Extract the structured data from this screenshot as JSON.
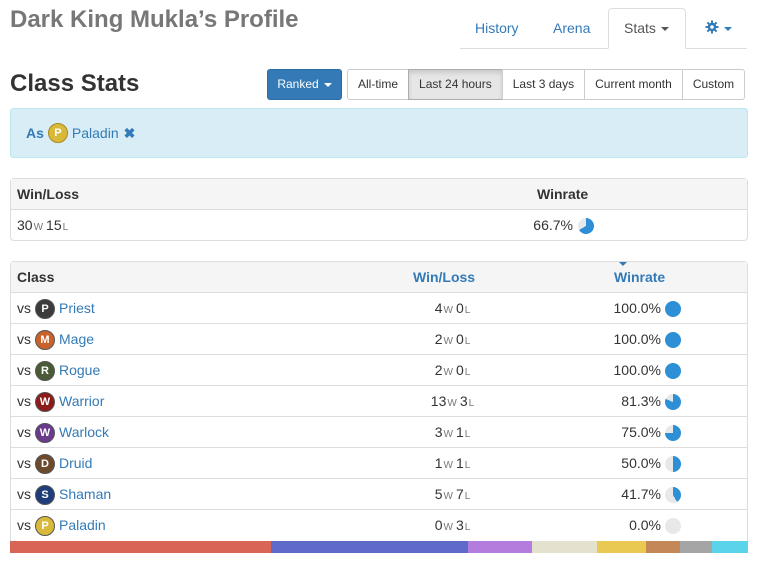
{
  "profile": {
    "title": "Dark King Mukla’s Profile"
  },
  "tabs": [
    {
      "label": "History"
    },
    {
      "label": "Arena"
    },
    {
      "label": "Stats"
    }
  ],
  "settings_icon": "gear-icon",
  "section": {
    "title": "Class Stats"
  },
  "mode": {
    "label": "Ranked"
  },
  "time_ranges": [
    {
      "label": "All-time",
      "active": false
    },
    {
      "label": "Last 24 hours",
      "active": true
    },
    {
      "label": "Last 3 days",
      "active": false
    },
    {
      "label": "Current month",
      "active": false
    },
    {
      "label": "Custom",
      "active": false
    }
  ],
  "filter": {
    "prefix": "As",
    "class": "Paladin",
    "remove_icon": "close-icon"
  },
  "summary": {
    "headers": {
      "winloss": "Win/Loss",
      "winrate": "Winrate"
    },
    "wins": "30",
    "losses": "15",
    "w_suffix": "W",
    "l_suffix": "L",
    "winrate": "66.7%",
    "winrate_value": 66.7
  },
  "class_table": {
    "headers": {
      "class": "Class",
      "winloss": "Win/Loss",
      "winrate": "Winrate"
    },
    "vs_label": "vs",
    "rows": [
      {
        "class": "Priest",
        "wins": "4",
        "losses": "0",
        "winrate": "100.0%",
        "winrate_value": 100.0,
        "icon_color": "#3b3b3b"
      },
      {
        "class": "Mage",
        "wins": "2",
        "losses": "0",
        "winrate": "100.0%",
        "winrate_value": 100.0,
        "icon_color": "#c8622a"
      },
      {
        "class": "Rogue",
        "wins": "2",
        "losses": "0",
        "winrate": "100.0%",
        "winrate_value": 100.0,
        "icon_color": "#4a5a36"
      },
      {
        "class": "Warrior",
        "wins": "13",
        "losses": "3",
        "winrate": "81.3%",
        "winrate_value": 81.3,
        "icon_color": "#8c1c1c"
      },
      {
        "class": "Warlock",
        "wins": "3",
        "losses": "1",
        "winrate": "75.0%",
        "winrate_value": 75.0,
        "icon_color": "#6a3b8c"
      },
      {
        "class": "Druid",
        "wins": "1",
        "losses": "1",
        "winrate": "50.0%",
        "winrate_value": 50.0,
        "icon_color": "#6b4a2e"
      },
      {
        "class": "Shaman",
        "wins": "5",
        "losses": "7",
        "winrate": "41.7%",
        "winrate_value": 41.7,
        "icon_color": "#1e3d7a"
      },
      {
        "class": "Paladin",
        "wins": "0",
        "losses": "3",
        "winrate": "0.0%",
        "winrate_value": 0.0,
        "icon_color": "#d9b93a"
      }
    ]
  },
  "color_bar": [
    {
      "share": 35.3,
      "color": "#d96557"
    },
    {
      "share": 26.7,
      "color": "#5e6bc9"
    },
    {
      "share": 8.7,
      "color": "#b47ddd"
    },
    {
      "share": 8.9,
      "color": "#e4e1cf"
    },
    {
      "share": 6.6,
      "color": "#e9c951"
    },
    {
      "share": 4.6,
      "color": "#c48858"
    },
    {
      "share": 4.3,
      "color": "#a5a5a5"
    },
    {
      "share": 4.9,
      "color": "#5bd3ea"
    }
  ],
  "colors": {
    "accent": "#337ab7",
    "pie_fill": "#2d8fd5",
    "pie_empty": "#e8e8e8"
  }
}
